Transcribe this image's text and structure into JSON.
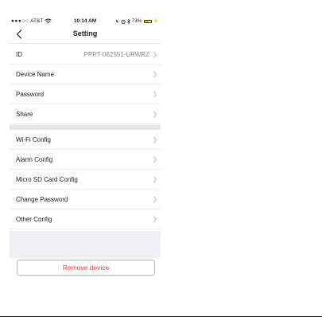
{
  "status_bar": {
    "carrier": "AT&T",
    "time": "10:14 AM",
    "battery_percent": "73%",
    "battery_level": 0.73
  },
  "nav": {
    "title": "Setting"
  },
  "group1": [
    {
      "label": "ID",
      "value": "PPRT-062551-URWRZ"
    },
    {
      "label": "Device Name",
      "value": ""
    },
    {
      "label": "Password",
      "value": ""
    },
    {
      "label": "Share",
      "value": ""
    }
  ],
  "group2": [
    {
      "label": "Wi-Fi Config"
    },
    {
      "label": "Alarm Config"
    },
    {
      "label": "Micro SD Card Config"
    },
    {
      "label": "Change Password"
    },
    {
      "label": "Other Config"
    }
  ],
  "remove_button": {
    "label": "Remove device",
    "color": "#e03a3a"
  },
  "icons": [
    "signal-dots-icon",
    "wifi-icon",
    "location-icon",
    "alarm-icon",
    "bluetooth-icon",
    "battery-icon",
    "charging-icon",
    "back-chevron-icon",
    "chevron-right-icon"
  ]
}
